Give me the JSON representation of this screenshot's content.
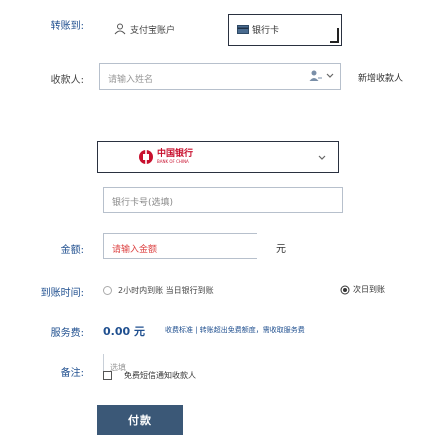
{
  "transfer_to": {
    "label": "转账到:",
    "tabs": [
      {
        "label": "支付宝账户"
      },
      {
        "label": "银行卡"
      }
    ]
  },
  "recipient": {
    "label": "收款人:",
    "placeholder": "请输入姓名",
    "extra_link": "新增收款人"
  },
  "bank": {
    "selected": "中国银行",
    "bank_en": "BANK OF CHINA",
    "card_placeholder": "银行卡号(选填)"
  },
  "amount": {
    "label": "金额:",
    "placeholder": "请输入金额",
    "unit": "元"
  },
  "arrival": {
    "label": "到账时间:",
    "option1": "2小时内到账 当日银行到账",
    "option2": "次日到账"
  },
  "fee": {
    "label": "服务费:",
    "value": "0.00 元",
    "info": "收费标准 | 转账超出免费额度，需收取服务费"
  },
  "remark": {
    "label": "备注:",
    "placeholder": "选填"
  },
  "notify": {
    "label": "免费短信通知收款人"
  },
  "submit": {
    "label": "付款"
  },
  "colors": {
    "button_bg": "#3b5877",
    "label_blue": "#1f4f8f",
    "bank_red": "#c8102e"
  }
}
